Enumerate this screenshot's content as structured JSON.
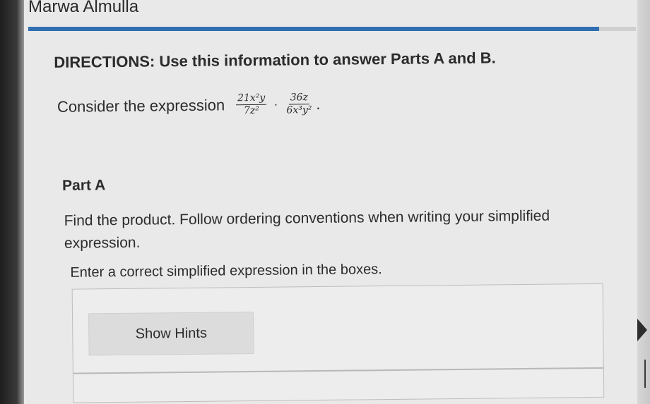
{
  "header": {
    "student_name": "Marwa Almulla"
  },
  "question": {
    "directions": "DIRECTIONS: Use this information to answer Parts A and B.",
    "consider_prefix": "Consider the expression",
    "fraction1": {
      "numerator": "21x²y",
      "denominator": "7z²"
    },
    "operator": "·",
    "fraction2": {
      "numerator": "36z",
      "denominator": "6x³y²"
    },
    "end_punct": "."
  },
  "part_a": {
    "title": "Part A",
    "instructions": "Find the product. Follow ordering conventions when writing your simplified expression.",
    "enter_prompt": "Enter a correct simplified expression in the boxes.",
    "show_hints_label": "Show Hints"
  },
  "colors": {
    "accent_rule": "#2f6fb2",
    "background": "#e9e9e9",
    "hint_button": "#dcdcdc"
  }
}
